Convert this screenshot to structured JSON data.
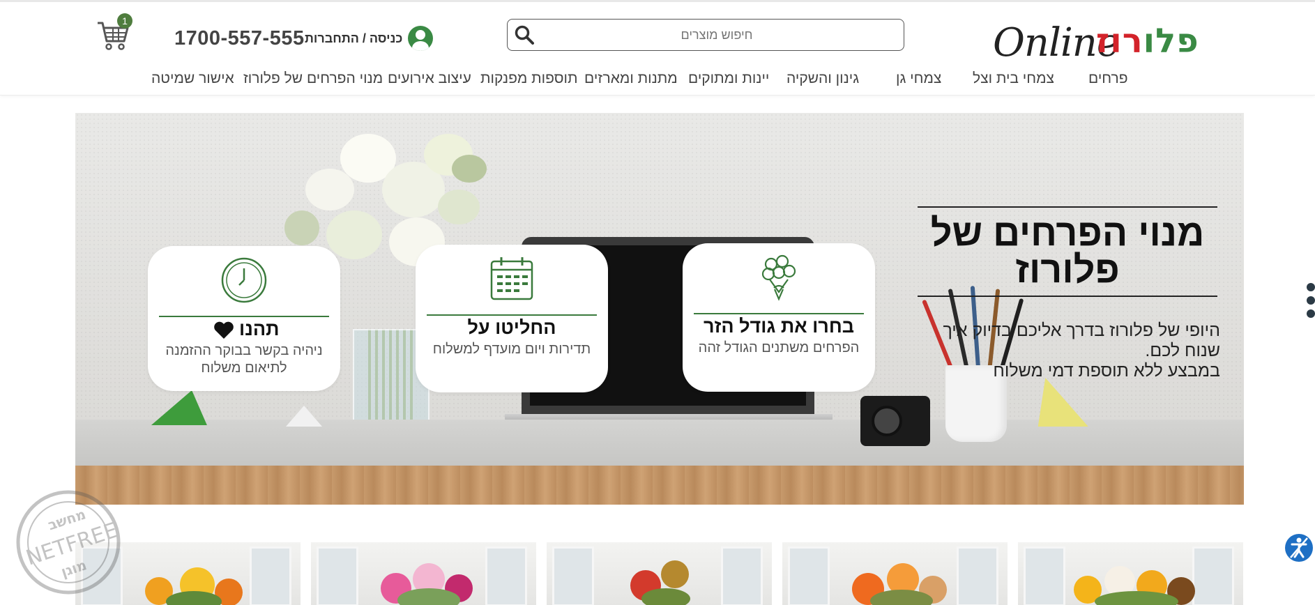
{
  "header": {
    "logo": {
      "latin": "Online",
      "hebrew_green": "פלו",
      "hebrew_red": "רוז"
    },
    "search": {
      "placeholder": "חיפוש מוצרים"
    },
    "login_label": "כניסה / התחברות",
    "phone": "1700-557-555",
    "cart_count": "1"
  },
  "nav": {
    "items": [
      "פרחים",
      "צמחי בית וצל",
      "צמחי גן",
      "גינון והשקיה",
      "יינות ומתוקים",
      "מתנות ומארזים",
      "תוספות מפנקות",
      "עיצוב אירועים",
      "מנוי הפרחים של פלורוז",
      "אישור שמיטה"
    ]
  },
  "hero": {
    "title": "מנוי הפרחים של פלורוז",
    "description": "היופי של פלורוז בדרך אליכם בדיוק איך שנוח לכם.\nבמבצע ללא תוספת דמי משלוח",
    "cards": [
      {
        "icon": "bouquet-icon",
        "title": "בחרו את גודל הזר",
        "text": "הפרחים משתנים הגודל זהה"
      },
      {
        "icon": "calendar-icon",
        "title": "החליטו על",
        "text": "תדירות ויום מועדף למשלוח"
      },
      {
        "icon": "clock-icon",
        "title": "תהנו",
        "text": "ניהיה בקשר בבוקר ההזמנה לתיאום משלוח"
      }
    ]
  },
  "products": [
    {
      "name": "product-1"
    },
    {
      "name": "product-2"
    },
    {
      "name": "product-3"
    },
    {
      "name": "product-4"
    },
    {
      "name": "product-5"
    }
  ],
  "watermark": {
    "top": "מחשב",
    "middle": "NETFREE",
    "bottom": "מוגן"
  },
  "colors": {
    "brand_green": "#3a8a44",
    "brand_red": "#d3232a",
    "cart_badge": "#4f7d3e",
    "accessibility_blue": "#1e6fc4"
  }
}
